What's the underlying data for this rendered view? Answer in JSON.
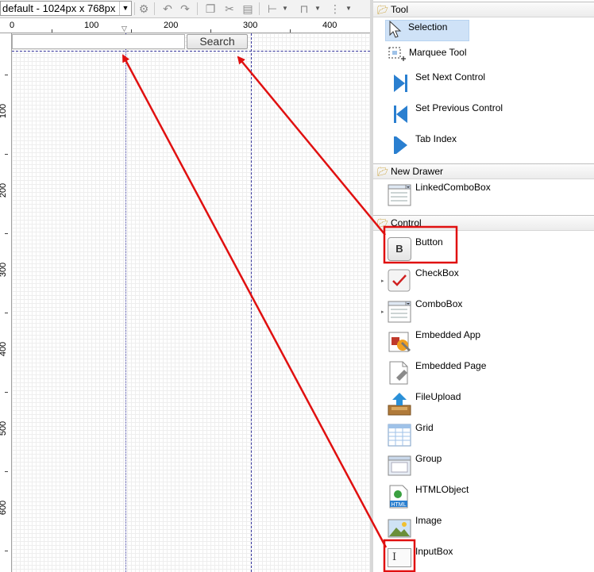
{
  "toolbar": {
    "resolution": "default - 1024px x 768px",
    "icons": [
      "gear-icon",
      "undo-icon",
      "redo-icon",
      "copy-icon",
      "cut-icon",
      "paste-icon",
      "align-icon",
      "distribute-icon",
      "layout-icon"
    ]
  },
  "rulers": {
    "horizontal": [
      "0",
      "100",
      "200",
      "300",
      "400"
    ],
    "vertical": [
      "100",
      "200",
      "300",
      "400",
      "500",
      "600"
    ]
  },
  "canvas": {
    "button_label": "Search"
  },
  "palette": {
    "drawers": [
      {
        "title": "Tool",
        "items": [
          {
            "label": "Selection"
          },
          {
            "label": "Marquee Tool"
          },
          {
            "label": "Set Next Control"
          },
          {
            "label": "Set Previous Control"
          },
          {
            "label": "Tab Index"
          }
        ]
      },
      {
        "title": "New Drawer",
        "items": [
          {
            "label": "LinkedComboBox"
          }
        ]
      },
      {
        "title": "Control",
        "items": [
          {
            "label": "Button"
          },
          {
            "label": "CheckBox"
          },
          {
            "label": "ComboBox"
          },
          {
            "label": "Embedded App"
          },
          {
            "label": "Embedded Page"
          },
          {
            "label": "FileUpload"
          },
          {
            "label": "Grid"
          },
          {
            "label": "Group"
          },
          {
            "label": "HTMLObject"
          },
          {
            "label": "Image"
          },
          {
            "label": "InputBox"
          }
        ]
      }
    ],
    "button_icon_glyph": "B",
    "html_icon_text": "HTML"
  },
  "annotation_color": "#e01010",
  "selection_color": "#cfe2f7"
}
